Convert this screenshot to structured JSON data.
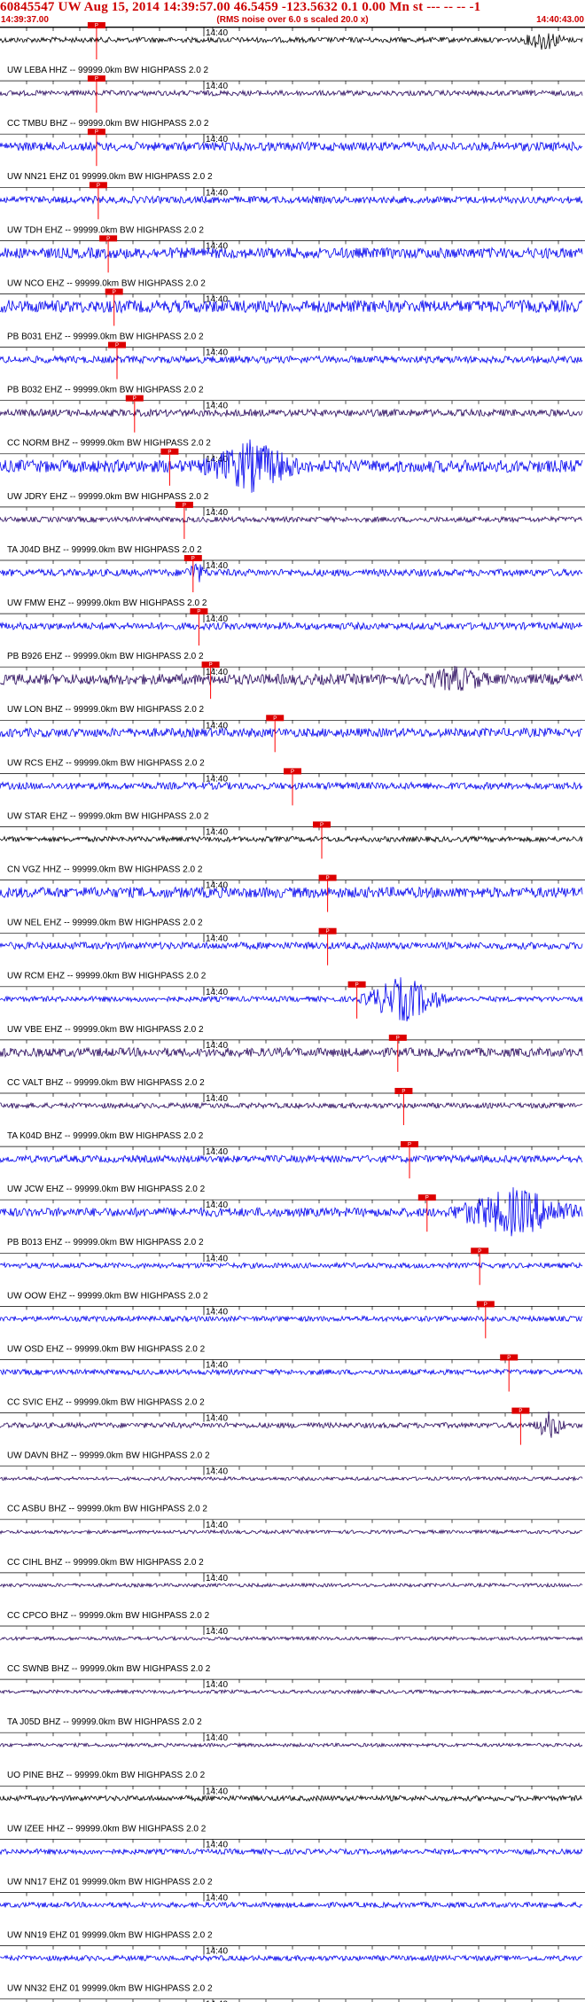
{
  "header": {
    "title": "60845547 UW Aug 15, 2014 14:39:57.00   46.5459 -123.5632  0.1 0.00 Mn st --- -- --  -1",
    "start_time": "14:39:37.00",
    "note": "(RMS noise over 6.0 s scaled 20.0 x)",
    "end_time": "14:40:43.00"
  },
  "time_mark_label": "14:40",
  "pick_label": "P",
  "colors": {
    "header_text": "#cc0000",
    "trace_blue": "#0000ee",
    "trace_navy": "#2a0a5e",
    "trace_black": "#000000",
    "pick_box": "#dd0000",
    "pick_line": "#ff0000",
    "grid": "#000000"
  },
  "traces": [
    {
      "label": "UW LEBA HHZ -- 99999.0km BW  HIGHPASS  2.0  2",
      "color": "black",
      "amp": 3,
      "pick": 0.165,
      "event": {
        "at": 0.93,
        "amp": 10,
        "w": 0.04
      }
    },
    {
      "label": "CC TMBU BHZ -- 99999.0km BW  HIGHPASS  2.0  2",
      "color": "navy",
      "amp": 3,
      "pick": 0.165
    },
    {
      "label": "UW NN21 EHZ 01 99999.0km BW  HIGHPASS  2.0  2",
      "color": "blue",
      "amp": 5,
      "pick": 0.165
    },
    {
      "label": "UW TDH EHZ -- 99999.0km BW  HIGHPASS  2.0  2",
      "color": "blue",
      "amp": 4,
      "pick": 0.168
    },
    {
      "label": "UW NCO EHZ -- 99999.0km BW  HIGHPASS  2.0  2",
      "color": "blue",
      "amp": 6,
      "pick": 0.185
    },
    {
      "label": "PB B031 EHZ -- 99999.0km BW  HIGHPASS  2.0  2",
      "color": "blue",
      "amp": 7,
      "pick": 0.195
    },
    {
      "label": "PB B032 EHZ -- 99999.0km BW  HIGHPASS  2.0  2",
      "color": "blue",
      "amp": 4,
      "pick": 0.2
    },
    {
      "label": "CC NORM BHZ -- 99999.0km BW  HIGHPASS  2.0  2",
      "color": "navy",
      "amp": 4,
      "pick": 0.23
    },
    {
      "label": "UW JDRY EHZ -- 99999.0km BW  HIGHPASS  2.0  2",
      "color": "blue",
      "amp": 7,
      "pick": 0.29,
      "event": {
        "at": 0.43,
        "amp": 24,
        "w": 0.09
      }
    },
    {
      "label": "TA J04D BHZ -- 99999.0km BW  HIGHPASS  2.0  2",
      "color": "navy",
      "amp": 3,
      "pick": 0.315
    },
    {
      "label": "UW FMW EHZ -- 99999.0km BW  HIGHPASS  2.0  2",
      "color": "blue",
      "amp": 4,
      "pick": 0.33,
      "event": {
        "at": 0.335,
        "amp": 10,
        "w": 0.02
      }
    },
    {
      "label": "PB B926 EHZ -- 99999.0km BW  HIGHPASS  2.0  2",
      "color": "blue",
      "amp": 4,
      "pick": 0.34
    },
    {
      "label": "UW LON BHZ -- 99999.0km BW  HIGHPASS  2.0  2",
      "color": "navy",
      "amp": 6,
      "pick": 0.36,
      "event": {
        "at": 0.78,
        "amp": 10,
        "w": 0.06
      }
    },
    {
      "label": "UW RCS EHZ -- 99999.0km BW  HIGHPASS  2.0  2",
      "color": "blue",
      "amp": 5,
      "pick": 0.47
    },
    {
      "label": "UW STAR EHZ -- 99999.0km BW  HIGHPASS  2.0  2",
      "color": "blue",
      "amp": 4,
      "pick": 0.5
    },
    {
      "label": "CN VGZ HHZ -- 99999.0km BW  HIGHPASS  2.0  2",
      "color": "black",
      "amp": 3,
      "pick": 0.55
    },
    {
      "label": "UW NEL EHZ -- 99999.0km BW  HIGHPASS  2.0  2",
      "color": "blue",
      "amp": 6,
      "pick": 0.56
    },
    {
      "label": "UW RCM EHZ -- 99999.0km BW  HIGHPASS  2.0  2",
      "color": "blue",
      "amp": 4,
      "pick": 0.56
    },
    {
      "label": "UW VBE EHZ -- 99999.0km BW  HIGHPASS  2.0  2",
      "color": "blue",
      "amp": 3,
      "pick": 0.61,
      "event": {
        "at": 0.69,
        "amp": 24,
        "w": 0.08,
        "square": true
      }
    },
    {
      "label": "CC VALT BHZ -- 99999.0km BW  HIGHPASS  2.0  2",
      "color": "navy",
      "amp": 5,
      "pick": 0.68
    },
    {
      "label": "TA K04D BHZ -- 99999.0km BW  HIGHPASS  2.0  2",
      "color": "navy",
      "amp": 3,
      "pick": 0.69
    },
    {
      "label": "UW JCW EHZ -- 99999.0km BW  HIGHPASS  2.0  2",
      "color": "blue",
      "amp": 4,
      "pick": 0.7
    },
    {
      "label": "PB B013 EHZ -- 99999.0km BW  HIGHPASS  2.0  2",
      "color": "blue",
      "amp": 5,
      "pick": 0.73,
      "event": {
        "at": 0.88,
        "amp": 24,
        "w": 0.12
      }
    },
    {
      "label": "UW OOW EHZ -- 99999.0km BW  HIGHPASS  2.0  2",
      "color": "blue",
      "amp": 3,
      "pick": 0.82
    },
    {
      "label": "UW OSD EHZ -- 99999.0km BW  HIGHPASS  2.0  2",
      "color": "blue",
      "amp": 3,
      "pick": 0.83
    },
    {
      "label": "CC SVIC EHZ -- 99999.0km BW  HIGHPASS  2.0  2",
      "color": "blue",
      "amp": 3,
      "pick": 0.87
    },
    {
      "label": "UW DAVN BHZ -- 99999.0km BW  HIGHPASS  2.0  2",
      "color": "navy",
      "amp": 3,
      "pick": 0.89,
      "event": {
        "at": 0.94,
        "amp": 14,
        "w": 0.03
      }
    },
    {
      "label": "CC ASBU BHZ -- 99999.0km BW  HIGHPASS  2.0  2",
      "color": "navy",
      "amp": 2
    },
    {
      "label": "CC CIHL BHZ -- 99999.0km BW  HIGHPASS  2.0  2",
      "color": "navy",
      "amp": 2
    },
    {
      "label": "CC CPCO BHZ -- 99999.0km BW  HIGHPASS  2.0  2",
      "color": "navy",
      "amp": 2
    },
    {
      "label": "CC SWNB BHZ -- 99999.0km BW  HIGHPASS  2.0  2",
      "color": "navy",
      "amp": 2
    },
    {
      "label": "TA J05D BHZ -- 99999.0km BW  HIGHPASS  2.0  2",
      "color": "navy",
      "amp": 2
    },
    {
      "label": "UO PINE BHZ -- 99999.0km BW  HIGHPASS  2.0  2",
      "color": "navy",
      "amp": 2
    },
    {
      "label": "UW IZEE HHZ -- 99999.0km BW  HIGHPASS  2.0  2",
      "color": "black",
      "amp": 3
    },
    {
      "label": "UW NN17 EHZ 01 99999.0km BW  HIGHPASS  2.0  2",
      "color": "blue",
      "amp": 3
    },
    {
      "label": "UW NN19 EHZ 01 99999.0km BW  HIGHPASS  2.0  2",
      "color": "blue",
      "amp": 3
    },
    {
      "label": "UW NN32 EHZ 01 99999.0km BW  HIGHPASS  2.0  2",
      "color": "blue",
      "amp": 3
    }
  ],
  "final_trace": {
    "color": "blue",
    "amp": 4
  }
}
